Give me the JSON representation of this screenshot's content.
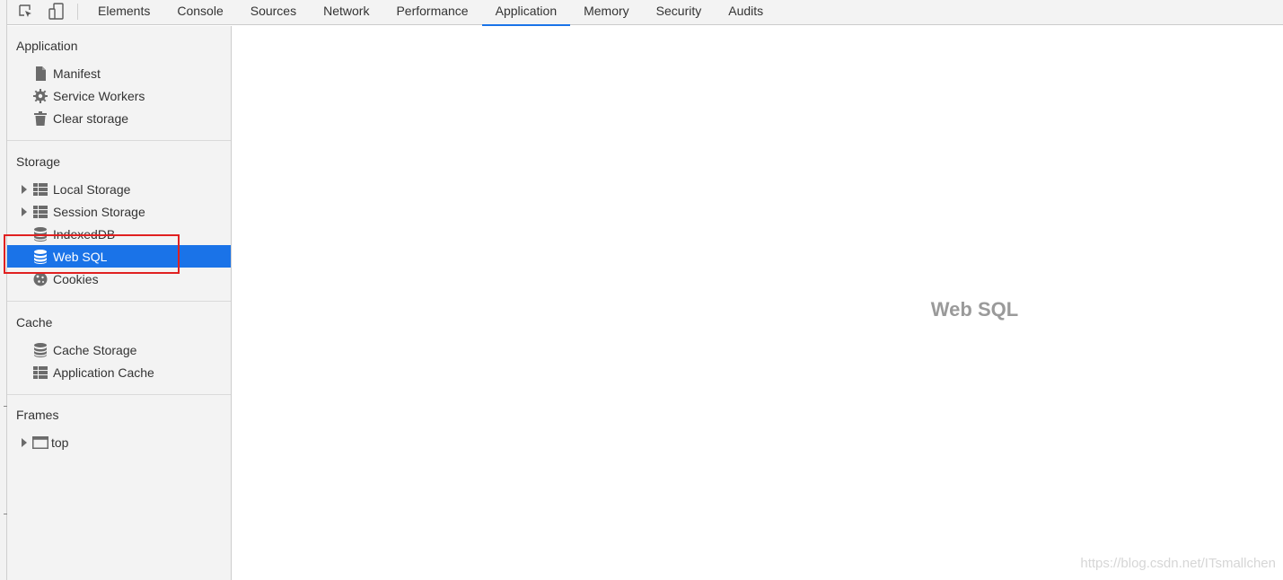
{
  "toolbar": {
    "icons": [
      "inspect-element-icon",
      "device-toolbar-icon"
    ],
    "tabs": [
      {
        "label": "Elements",
        "selected": false
      },
      {
        "label": "Console",
        "selected": false
      },
      {
        "label": "Sources",
        "selected": false
      },
      {
        "label": "Network",
        "selected": false
      },
      {
        "label": "Performance",
        "selected": false
      },
      {
        "label": "Application",
        "selected": true
      },
      {
        "label": "Memory",
        "selected": false
      },
      {
        "label": "Security",
        "selected": false
      },
      {
        "label": "Audits",
        "selected": false
      }
    ],
    "accent_color": "#1a73e8"
  },
  "sidebar": {
    "sections": [
      {
        "title": "Application",
        "items": [
          {
            "label": "Manifest",
            "icon": "document-icon",
            "expandable": false
          },
          {
            "label": "Service Workers",
            "icon": "gear-icon",
            "expandable": false
          },
          {
            "label": "Clear storage",
            "icon": "trash-icon",
            "expandable": false
          }
        ]
      },
      {
        "title": "Storage",
        "items": [
          {
            "label": "Local Storage",
            "icon": "table-icon",
            "expandable": true
          },
          {
            "label": "Session Storage",
            "icon": "table-icon",
            "expandable": true
          },
          {
            "label": "IndexedDB",
            "icon": "database-icon",
            "expandable": false
          },
          {
            "label": "Web SQL",
            "icon": "database-icon",
            "expandable": false,
            "selected": true
          },
          {
            "label": "Cookies",
            "icon": "cookie-icon",
            "expandable": false
          }
        ]
      },
      {
        "title": "Cache",
        "items": [
          {
            "label": "Cache Storage",
            "icon": "database-icon",
            "expandable": false
          },
          {
            "label": "Application Cache",
            "icon": "table-icon",
            "expandable": false
          }
        ]
      },
      {
        "title": "Frames",
        "items": [
          {
            "label": "top",
            "icon": "frame-icon",
            "expandable": true
          }
        ]
      }
    ],
    "selected_color": "#1a73e8",
    "highlight_box_color": "#e02020"
  },
  "main": {
    "title": "Web SQL"
  },
  "watermark": "https://blog.csdn.net/ITsmallchen"
}
